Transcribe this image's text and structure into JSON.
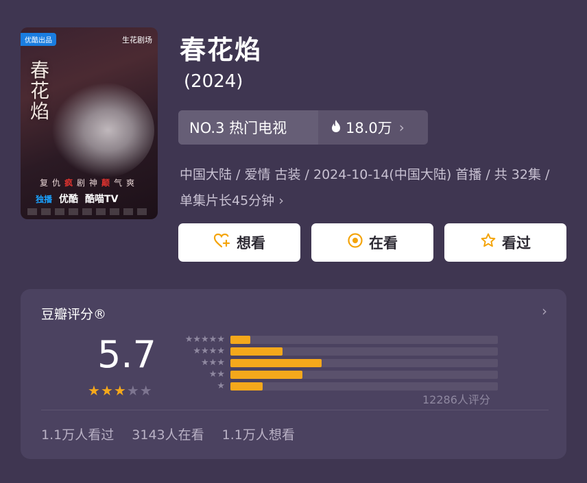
{
  "poster": {
    "badge": "优酷出品",
    "studio": "生花剧场",
    "calligraphy": "春花焰",
    "tagline_parts": [
      "复仇",
      "疯",
      "剧",
      "神",
      "颠",
      "气",
      "爽"
    ],
    "platform_mark": "独播",
    "platform_1": "优酷",
    "platform_2": "酷喵TV"
  },
  "title": "春花焰",
  "year": "(2024)",
  "rank": {
    "label": "NO.3 热门电视",
    "heat_icon": "fire-icon",
    "heat": "18.0万"
  },
  "meta": {
    "line": "中国大陆 / 爱情 古装 / 2024-10-14(中国大陆) 首播 / 共 32集 / 单集片长45分钟"
  },
  "actions": {
    "want": "想看",
    "watching": "在看",
    "watched": "看过"
  },
  "rating": {
    "title": "豆瓣评分®",
    "score": "5.7",
    "stars_filled": 3,
    "stars_total": 5,
    "distribution_fractions": [
      0.075,
      0.195,
      0.34,
      0.27,
      0.12
    ],
    "votes": "12286人评分"
  },
  "stats": {
    "watched": "1.1万人看过",
    "watching": "3143人在看",
    "want": "1.1万人想看"
  },
  "colors": {
    "background": "#3f3651",
    "card": "#4b4260",
    "accent": "#f5a81b"
  }
}
